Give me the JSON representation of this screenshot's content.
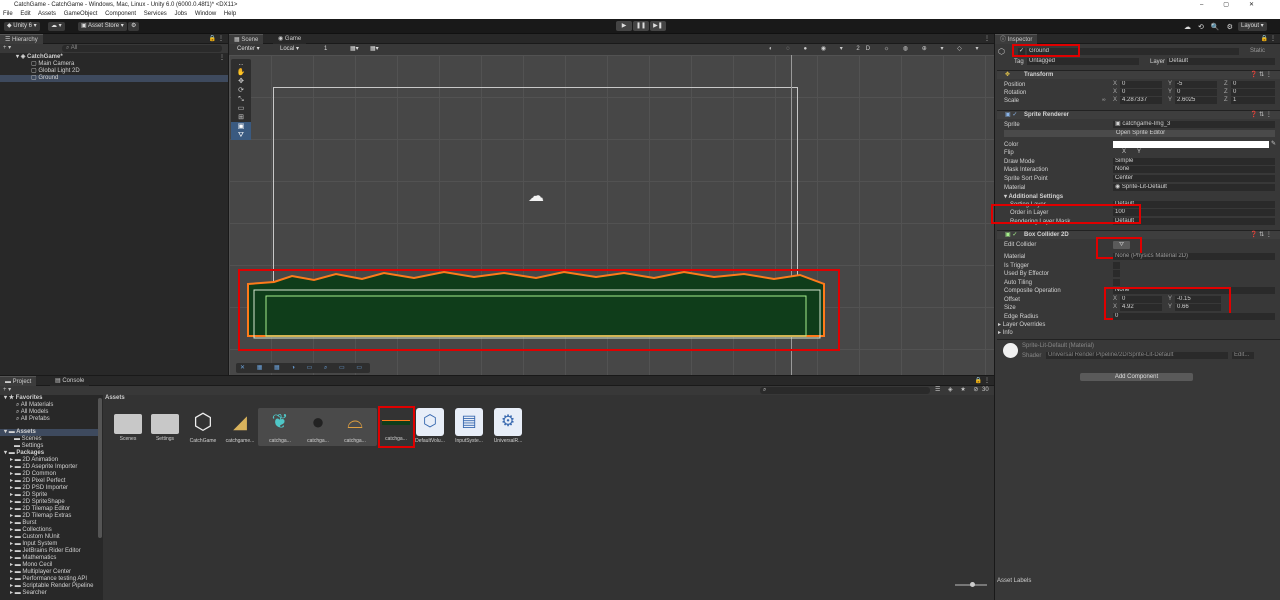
{
  "window": {
    "title": "CatchGame - CatchGame - Windows, Mac, Linux - Unity 6.0 (6000.0.48f1)* <DX11>"
  },
  "menu": [
    "File",
    "Edit",
    "Assets",
    "GameObject",
    "Component",
    "Services",
    "Jobs",
    "Window",
    "Help"
  ],
  "toolbar": {
    "account": "Unity 6",
    "asset_store": "Asset Store",
    "layout": "Layout"
  },
  "hierarchy": {
    "tab": "Hierarchy",
    "search_placeholder": "All",
    "scene": "CatchGame*",
    "items": [
      "Main Camera",
      "Global Light 2D",
      "Ground"
    ]
  },
  "scene_view": {
    "tabs": [
      "Scene",
      "Game"
    ],
    "pivot": "Center",
    "space": "Local",
    "grid_snap": "1"
  },
  "inspector": {
    "tab": "Inspector",
    "object_name": "Ground",
    "static_label": "Static",
    "tag_label": "Tag",
    "tag": "Untagged",
    "layer_label": "Layer",
    "layer": "Default",
    "transform": {
      "title": "Transform",
      "position_label": "Position",
      "position": {
        "x": "0",
        "y": "-5",
        "z": "0"
      },
      "rotation_label": "Rotation",
      "rotation": {
        "x": "0",
        "y": "0",
        "z": "0"
      },
      "scale_label": "Scale",
      "scale": {
        "x": "4.287337",
        "y": "2.6025",
        "z": "1"
      }
    },
    "sprite_renderer": {
      "title": "Sprite Renderer",
      "sprite_label": "Sprite",
      "sprite": "catchgame-Img_3",
      "open_editor": "Open Sprite Editor",
      "color_label": "Color",
      "flip_label": "Flip",
      "flip_x": "X",
      "flip_y": "Y",
      "draw_mode_label": "Draw Mode",
      "draw_mode": "Simple",
      "mask_label": "Mask Interaction",
      "mask": "None",
      "sort_point_label": "Sprite Sort Point",
      "sort_point": "Center",
      "material_label": "Material",
      "material": "Sprite-Lit-Default",
      "additional": "Additional Settings",
      "sorting_layer_label": "Sorting Layer",
      "sorting_layer": "Default",
      "order_label": "Order in Layer",
      "order": "100",
      "rendering_mask_label": "Rendering Layer Mask",
      "rendering_mask": "Default"
    },
    "box_collider": {
      "title": "Box Collider 2D",
      "edit_label": "Edit Collider",
      "material_label": "Material",
      "material": "None (Physics Material 2D)",
      "trigger_label": "Is Trigger",
      "effector_label": "Used By Effector",
      "autotiling_label": "Auto Tiling",
      "composite_label": "Composite Operation",
      "composite": "None",
      "offset_label": "Offset",
      "offset": {
        "x": "0",
        "y": "-0.15"
      },
      "size_label": "Size",
      "size": {
        "x": "4.92",
        "y": "0.66"
      },
      "edge_label": "Edge Radius",
      "edge": "0",
      "layer_overrides": "Layer Overrides",
      "info": "Info"
    },
    "material_block": {
      "name": "Sprite-Lit-Default (Material)",
      "shader_label": "Shader",
      "shader": "Universal Render Pipeline/2D/Sprite-Lit-Default",
      "edit": "Edit..."
    },
    "add_component": "Add Component",
    "asset_labels": "Asset Labels"
  },
  "project": {
    "tabs": [
      "Project",
      "Console"
    ],
    "breadcrumb": "Assets",
    "hidden_count": "30",
    "favorites": {
      "title": "Favorites",
      "items": [
        "All Materials",
        "All Models",
        "All Prefabs"
      ]
    },
    "assets_tree": {
      "title": "Assets",
      "items": [
        "Scenes",
        "Settings"
      ]
    },
    "packages": {
      "title": "Packages",
      "items": [
        "2D Animation",
        "2D Aseprite Importer",
        "2D Common",
        "2D Pixel Perfect",
        "2D PSD Importer",
        "2D Sprite",
        "2D SpriteShape",
        "2D Tilemap Editor",
        "2D Tilemap Extras",
        "Burst",
        "Collections",
        "Custom NUnit",
        "Input System",
        "JetBrains Rider Editor",
        "Mathematics",
        "Mono Cecil",
        "Multiplayer Center",
        "Performance testing API",
        "Scriptable Render Pipeline",
        "Searcher"
      ]
    },
    "assets": [
      "Scenes",
      "Settings",
      "CatchGame",
      "catchgame...",
      "catchga...",
      "catchga...",
      "catchga...",
      "catchga...",
      "DefaultVolu...",
      "InputSyste...",
      "UniversalR..."
    ]
  },
  "colors": {
    "highlight": "#e00000",
    "collider": "#a6f08c",
    "ground_outline": "#ff7a1a",
    "ground_fill": "#0f3d1a"
  }
}
